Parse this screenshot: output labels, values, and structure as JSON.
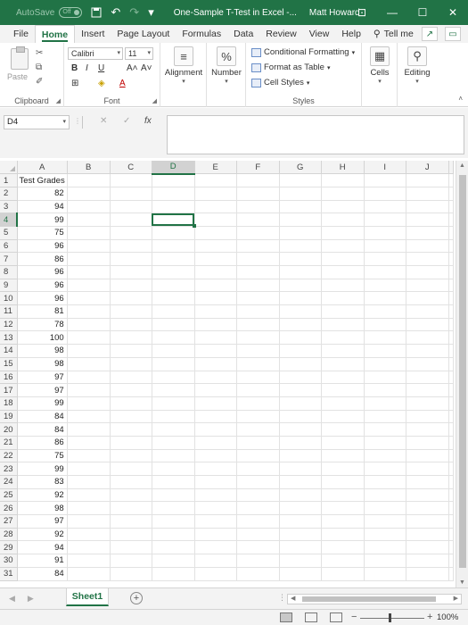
{
  "titlebar": {
    "autosave_label": "AutoSave",
    "autosave_state": "Off",
    "title": "One-Sample T-Test in Excel -...",
    "user": "Matt Howard"
  },
  "tabs": [
    "File",
    "Home",
    "Insert",
    "Page Layout",
    "Formulas",
    "Data",
    "Review",
    "View",
    "Help"
  ],
  "active_tab": "Home",
  "tell_me": "Tell me",
  "ribbon": {
    "clipboard": {
      "label": "Clipboard",
      "paste": "Paste"
    },
    "font": {
      "label": "Font",
      "name": "Calibri",
      "size": "11"
    },
    "alignment": "Alignment",
    "number": "Number",
    "styles": {
      "label": "Styles",
      "conditional": "Conditional Formatting",
      "format_table": "Format as Table",
      "cell_styles": "Cell Styles"
    },
    "cells": "Cells",
    "editing": "Editing"
  },
  "formula_bar": {
    "name_box": "D4",
    "formula": ""
  },
  "columns": [
    "A",
    "B",
    "C",
    "D",
    "E",
    "F",
    "G",
    "H",
    "I",
    "J"
  ],
  "active_cell": {
    "col": "D",
    "row": 4
  },
  "header_cell": "Test Grades",
  "grades": [
    82,
    94,
    99,
    75,
    96,
    86,
    96,
    96,
    96,
    81,
    78,
    100,
    98,
    98,
    97,
    97,
    99,
    84,
    84,
    86,
    75,
    99,
    83,
    92,
    98,
    97,
    92,
    94,
    91,
    84
  ],
  "sheet": {
    "name": "Sheet1"
  },
  "status": {
    "zoom": "100%"
  }
}
